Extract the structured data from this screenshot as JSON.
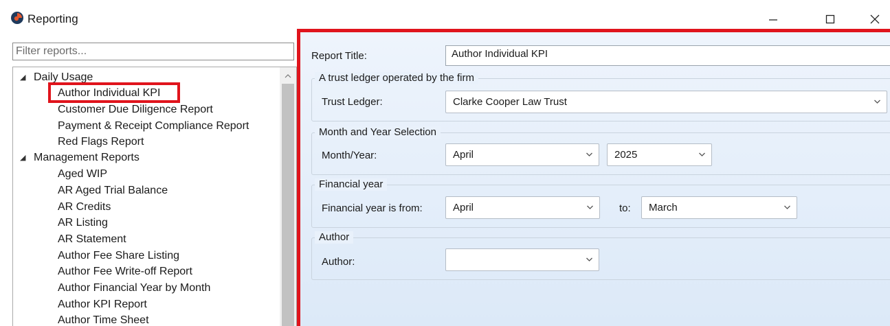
{
  "window": {
    "title": "Reporting",
    "controls": {
      "minimize": "minimize-icon",
      "maximize": "maximize-icon",
      "close": "close-icon"
    }
  },
  "filter": {
    "placeholder": "Filter reports...",
    "value": ""
  },
  "tree": {
    "groups": [
      {
        "label": "Daily Usage",
        "expanded": true,
        "items": [
          "Author Individual KPI",
          "Customer Due Diligence Report",
          "Payment & Receipt Compliance Report",
          "Red Flags Report"
        ]
      },
      {
        "label": "Management Reports",
        "expanded": true,
        "items": [
          "Aged WIP",
          "AR Aged Trial Balance",
          "AR Credits",
          "AR Listing",
          "AR Statement",
          "Author Fee Share Listing",
          "Author Fee Write-off Report",
          "Author Financial Year by Month",
          "Author KPI Report",
          "Author Time Sheet"
        ]
      }
    ],
    "selected": "Author Individual KPI"
  },
  "form": {
    "report_title": {
      "label": "Report Title:",
      "value": "Author Individual KPI"
    },
    "trust_group": {
      "title": "A trust ledger operated by the firm",
      "label": "Trust Ledger:",
      "value": "Clarke Cooper Law Trust"
    },
    "month_group": {
      "title": "Month and Year Selection",
      "label": "Month/Year:",
      "month": "April",
      "year": "2025"
    },
    "financial_group": {
      "title": "Financial year",
      "label": "Financial year is from:",
      "from": "April",
      "to_label": "to:",
      "to": "March"
    },
    "author_group": {
      "title": "Author",
      "label": "Author:",
      "value": ""
    }
  },
  "colors": {
    "highlight": "#e0141c",
    "panel_bg": "#e4eefa",
    "accent_icon": "#e4572e"
  }
}
